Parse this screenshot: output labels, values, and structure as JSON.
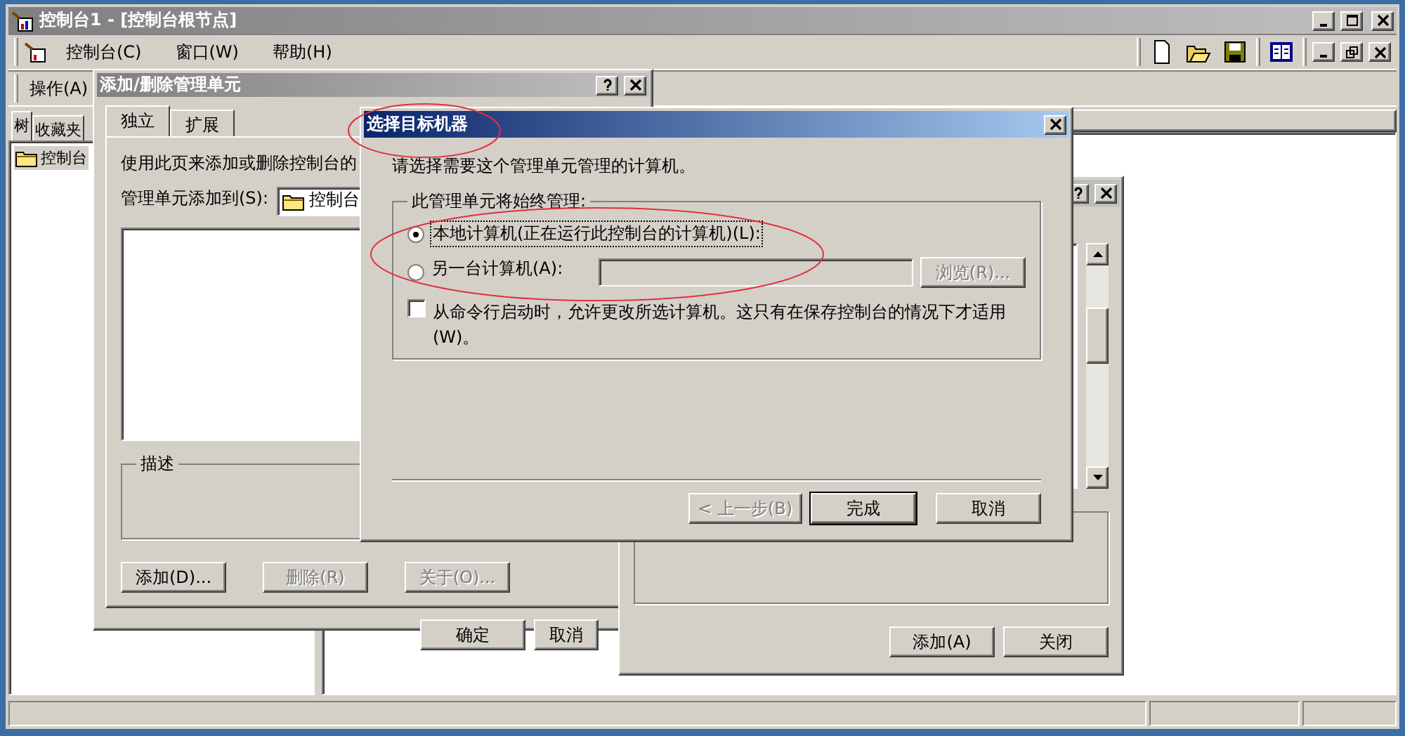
{
  "window": {
    "title": "控制台1 - [控制台根节点]"
  },
  "menu": [
    "控制台(C)",
    "窗口(W)",
    "帮助(H)"
  ],
  "action_menu": "操作(A)",
  "tree_tabs": [
    {
      "label": "树",
      "selected": true
    },
    {
      "label": "收藏夹",
      "selected": false
    }
  ],
  "tree": [
    {
      "label": "控制台",
      "selected": true
    }
  ],
  "add_remove_dialog": {
    "title": "添加/删除管理单元",
    "tabs": [
      {
        "label": "独立",
        "selected": true
      },
      {
        "label": "扩展",
        "selected": false
      }
    ],
    "intro": "使用此页来添加或删除控制台的",
    "add_to_label": "管理单元添加到(S):",
    "add_to_value": "控制台",
    "description_label": "描述",
    "buttons": [
      {
        "label": "添加(D)...",
        "disabled": false
      },
      {
        "label": "删除(R)",
        "disabled": true
      },
      {
        "label": "关于(O)...",
        "disabled": true
      }
    ],
    "footer_buttons": [
      "确定",
      "取消"
    ]
  },
  "add_standalone_dialog": {
    "buttons": [
      "添加(A)",
      "关闭"
    ]
  },
  "target_dialog": {
    "title": "选择目标机器",
    "prompt": "请选择需要这个管理单元管理的计算机。",
    "group_label": "此管理单元将始终管理:",
    "options": [
      {
        "label": "本地计算机(正在运行此控制台的计算机)(L):",
        "selected": true
      },
      {
        "label": "另一台计算机(A):",
        "selected": false
      }
    ],
    "computer_field": {
      "disabled": true
    },
    "browse_button": {
      "label": "浏览(R)...",
      "disabled": true
    },
    "allow_change": {
      "label": "从命令行启动时，允许更改所选计算机。这只有在保存控制台的情况下才适用(W)。",
      "checked": false
    },
    "buttons": [
      {
        "label": "< 上一步(B)",
        "disabled": true,
        "default": false
      },
      {
        "label": "完成",
        "disabled": false,
        "default": true
      },
      {
        "label": "取消",
        "disabled": false,
        "default": false
      }
    ]
  }
}
